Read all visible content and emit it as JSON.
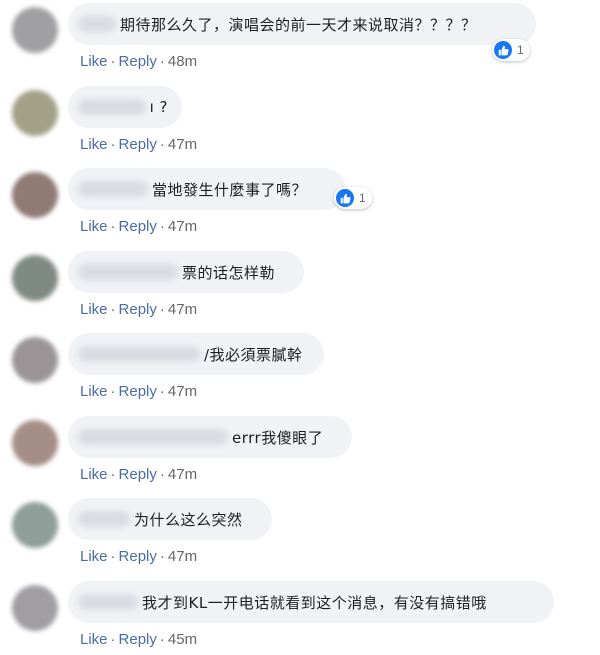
{
  "comments": [
    {
      "text": "期待那么久了，演唱会的前一天才来说取消？？？？",
      "actions": {
        "like": "Like",
        "reply": "Reply",
        "time": "48m"
      },
      "reactions": "1",
      "avatar_color": "#a0a0a2"
    },
    {
      "text": "ı ?",
      "actions": {
        "like": "Like",
        "reply": "Reply",
        "time": "47m"
      },
      "avatar_color": "#a3a087"
    },
    {
      "text": "當地發生什麼事了嗎？",
      "actions": {
        "like": "Like",
        "reply": "Reply",
        "time": "47m"
      },
      "reactions": "1",
      "avatar_color": "#8f7a74"
    },
    {
      "text": "票的话怎样勒",
      "actions": {
        "like": "Like",
        "reply": "Reply",
        "time": "47m"
      },
      "avatar_color": "#7f8a84"
    },
    {
      "text": "/我必須票膩幹",
      "actions": {
        "like": "Like",
        "reply": "Reply",
        "time": "47m"
      },
      "avatar_color": "#9a9496"
    },
    {
      "text": "errr我傻眼了",
      "actions": {
        "like": "Like",
        "reply": "Reply",
        "time": "47m"
      },
      "avatar_color": "#a58e86"
    },
    {
      "text": "为什么这么突然",
      "actions": {
        "like": "Like",
        "reply": "Reply",
        "time": "47m"
      },
      "avatar_color": "#8e9e98"
    },
    {
      "text": "我才到KL一开电话就看到这个消息，有没有搞错哦",
      "actions": {
        "like": "Like",
        "reply": "Reply",
        "time": "45m"
      },
      "avatar_color": "#a09ea3"
    }
  ]
}
